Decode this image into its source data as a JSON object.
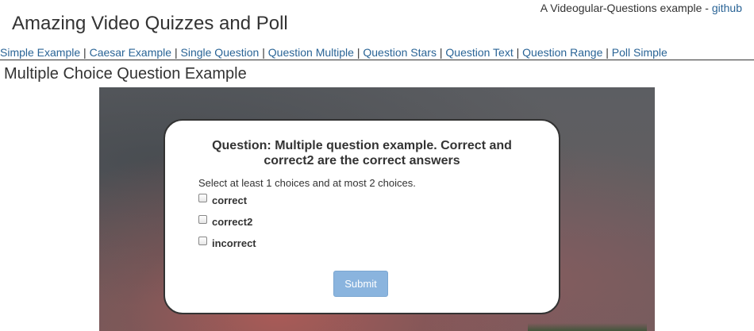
{
  "header": {
    "title": "Amazing Video Quizzes and Poll",
    "note_text": "A Videogular-Questions example - ",
    "note_link": "github"
  },
  "nav": {
    "items": [
      {
        "label": "Simple Example"
      },
      {
        "label": "Caesar Example"
      },
      {
        "label": "Single Question"
      },
      {
        "label": "Question Multiple"
      },
      {
        "label": "Question Stars"
      },
      {
        "label": "Question Text"
      },
      {
        "label": "Question Range"
      },
      {
        "label": "Poll Simple"
      }
    ],
    "separator": "|"
  },
  "page": {
    "title": "Multiple Choice Question Example"
  },
  "quiz": {
    "question": "Question: Multiple question example. Correct and correct2 are the correct answers",
    "instructions": "Select at least 1 choices and at most 2 choices.",
    "choices": [
      {
        "label": "correct",
        "checked": false
      },
      {
        "label": "correct2",
        "checked": false
      },
      {
        "label": "incorrect",
        "checked": false
      }
    ],
    "submit_label": "Submit",
    "submit_color": "#8ab4de"
  }
}
